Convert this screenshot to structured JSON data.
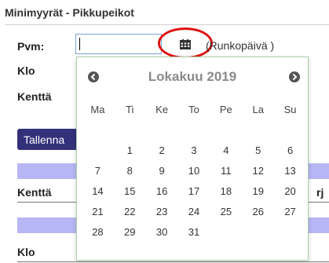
{
  "header": {
    "title": "Minimyyrät - Pikkupeikot"
  },
  "form": {
    "date_label": "Pvm:",
    "date_value": "",
    "date_hint": "(Runkopäivä )",
    "time_label": "Klo",
    "field_label": "Kenttä",
    "save_label": "Tallenna"
  },
  "tables": {
    "first_header": "Kenttä",
    "first_header_right_fragment": "rj",
    "second_header": "Klo"
  },
  "datepicker": {
    "month_title": "Lokakuu 2019",
    "weekdays": [
      "Ma",
      "Ti",
      "Ke",
      "To",
      "Pe",
      "La",
      "Su"
    ],
    "weeks": [
      [
        "",
        "1",
        "2",
        "3",
        "4",
        "5",
        "6"
      ],
      [
        "7",
        "8",
        "9",
        "10",
        "11",
        "12",
        "13"
      ],
      [
        "14",
        "15",
        "16",
        "17",
        "18",
        "19",
        "20"
      ],
      [
        "21",
        "22",
        "23",
        "24",
        "25",
        "26",
        "27"
      ],
      [
        "28",
        "29",
        "30",
        "31",
        "",
        "",
        ""
      ]
    ]
  },
  "colors": {
    "accent": "#33317a",
    "band": "#b7b7f5",
    "highlight_ring": "#e01010",
    "input_border": "#7aa7d8"
  }
}
